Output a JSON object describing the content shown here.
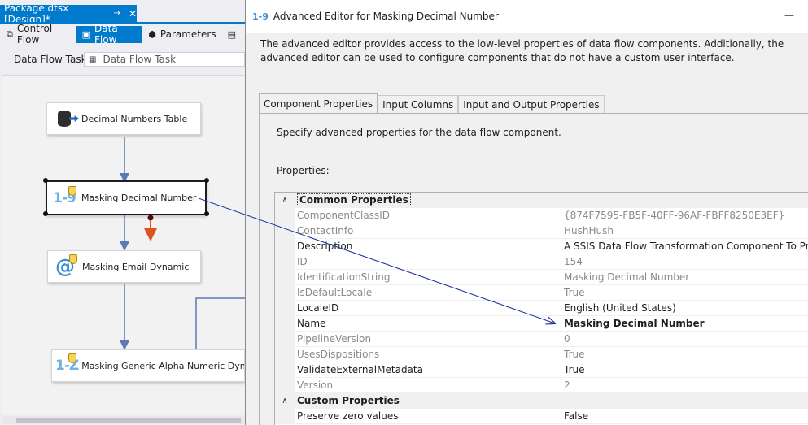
{
  "designer": {
    "doc_tab": {
      "label": "Package.dtsx [Design]*",
      "pin": "→",
      "close": "✕"
    },
    "tabs": [
      {
        "label": "Control Flow",
        "icon": "control-flow-icon",
        "glyph": "⧉"
      },
      {
        "label": "Data Flow",
        "icon": "data-flow-icon",
        "glyph": "▣"
      },
      {
        "label": "Parameters",
        "icon": "parameters-icon",
        "glyph": "⬢"
      },
      {
        "label": "",
        "icon": "event-handlers-icon",
        "glyph": "▤"
      }
    ],
    "task_label": "Data Flow Task:",
    "task_value": "Data Flow Task",
    "nodes": {
      "source": {
        "label": "Decimal Numbers Table",
        "icon": "database-source-icon"
      },
      "decimal": {
        "label": "Masking Decimal Number",
        "icon": "number-mask-icon",
        "glyph": "1-9"
      },
      "email": {
        "label": "Masking Email Dynamic",
        "icon": "email-mask-icon",
        "glyph": "@"
      },
      "alpha": {
        "label": "Masking Generic Alpha Numeric Dynamic",
        "icon": "alpha-mask-icon",
        "glyph": "1-Z"
      }
    }
  },
  "dialog": {
    "title": "Advanced Editor for Masking Decimal Number",
    "title_icon": "1-9",
    "minimize": "—",
    "intro": "The advanced editor provides access to the low-level properties of data flow components. Additionally, the advanced editor can be used to configure components that do not have a custom user interface.",
    "tabs": [
      "Component Properties",
      "Input Columns",
      "Input and Output Properties"
    ],
    "hint": "Specify advanced properties for the data flow component.",
    "properties_label": "Properties:",
    "categories": {
      "common": "Common Properties",
      "custom": "Custom Properties"
    },
    "collapse_glyph": "∧",
    "rows": [
      {
        "name": "ComponentClassID",
        "value": "{874F7595-FB5F-40FF-96AF-FBFF8250E3EF}",
        "dim": true
      },
      {
        "name": "ContactInfo",
        "value": "HushHush",
        "dim": true
      },
      {
        "name": "Description",
        "value": "A SSIS Data Flow Transformation Component To Provide Data Masking",
        "dim": false
      },
      {
        "name": "ID",
        "value": "154",
        "dim": true
      },
      {
        "name": "IdentificationString",
        "value": "Masking Decimal Number",
        "dim": true
      },
      {
        "name": "IsDefaultLocale",
        "value": "True",
        "dim": true
      },
      {
        "name": "LocaleID",
        "value": "English (United States)",
        "dim": false
      },
      {
        "name": "Name",
        "value": "Masking Decimal Number",
        "dim": false,
        "bold": true
      },
      {
        "name": "PipelineVersion",
        "value": "0",
        "dim": true
      },
      {
        "name": "UsesDispositions",
        "value": "True",
        "dim": true
      },
      {
        "name": "ValidateExternalMetadata",
        "value": "True",
        "dim": false
      },
      {
        "name": "Version",
        "value": "2",
        "dim": true
      }
    ],
    "custom_rows": [
      {
        "name": "Preserve zero values",
        "value": "False",
        "dim": false
      }
    ]
  },
  "colors": {
    "accent": "#007acc",
    "connector": "#5a7bb5",
    "annotation": "#1a2f9c",
    "error_arrow": "#d9541e"
  }
}
